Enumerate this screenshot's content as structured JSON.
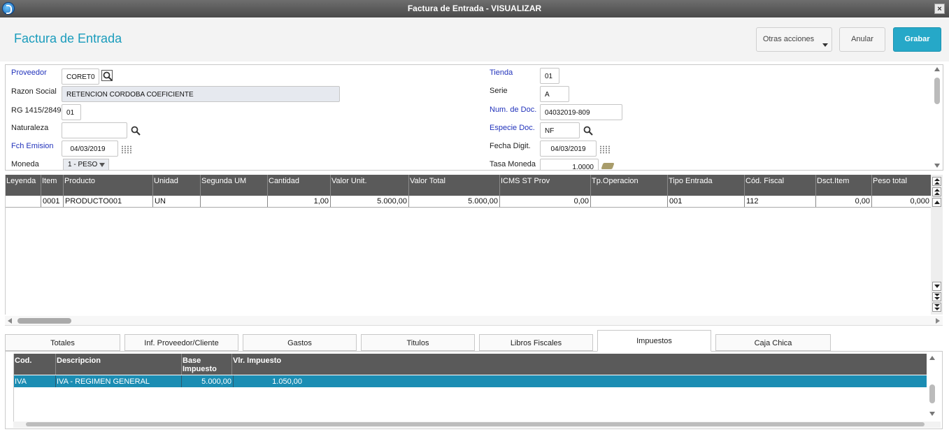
{
  "window": {
    "title": "Factura de Entrada - VISUALIZAR",
    "close": "×"
  },
  "header": {
    "title": "Factura de Entrada",
    "otras_acciones": "Otras acciones",
    "anular": "Anular",
    "grabar": "Grabar"
  },
  "form": {
    "proveedor_label": "Proveedor",
    "proveedor": "CORET0",
    "razon_social_label": "Razon Social",
    "razon_social": "RETENCION CORDOBA COEFICIENTE",
    "rg_label": "RG 1415/2849",
    "rg": "01",
    "naturaleza_label": "Naturaleza",
    "naturaleza": "",
    "fch_emision_label": "Fch Emision",
    "fch_emision": "04/03/2019",
    "moneda_label": "Moneda",
    "moneda": "1 - PESO",
    "tienda_label": "Tienda",
    "tienda": "01",
    "serie_label": "Serie",
    "serie": "A",
    "num_doc_label": "Num. de Doc.",
    "num_doc": "04032019-809",
    "especie_label": "Especie Doc.",
    "especie": "NF",
    "fecha_digit_label": "Fecha Digit.",
    "fecha_digit": "04/03/2019",
    "tasa_label": "Tasa Moneda",
    "tasa": "1.0000"
  },
  "items_grid": {
    "columns": [
      "Leyenda",
      "Item",
      "Producto",
      "Unidad",
      "Segunda UM",
      "Cantidad",
      "Valor Unit.",
      "Valor Total",
      "ICMS ST Prov",
      "Tp.Operacion",
      "Tipo Entrada",
      "Cód. Fiscal",
      "Dsct.Item",
      "Peso total"
    ],
    "row": {
      "leyenda": "",
      "item": "0001",
      "producto": "PRODUCTO001",
      "unidad": "UN",
      "segunda_um": "",
      "cantidad": "1,00",
      "valor_unit": "5.000,00",
      "valor_total": "5.000,00",
      "icms": "0,00",
      "tp_operacion": "",
      "tipo_entrada": "001",
      "cod_fiscal": "112",
      "dsct_item": "0,00",
      "peso_total": "0,000"
    }
  },
  "tabs": [
    "Totales",
    "Inf. Proveedor/Cliente",
    "Gastos",
    "Titulos",
    "Libros Fiscales",
    "Impuestos",
    "Caja Chica"
  ],
  "active_tab": "Impuestos",
  "tax_grid": {
    "columns": [
      "Cod.",
      "Descripcion",
      "Base Impuesto",
      "Vlr. Impuesto"
    ],
    "row": {
      "cod": "IVA",
      "descripcion": "IVA - REGIMEN GENERAL",
      "base": "5.000,00",
      "valor": "1.050,00"
    }
  },
  "colors": {
    "accent": "#26a8c8",
    "title": "#1a9cbc",
    "header_grid": "#5a5a5a",
    "selected_row": "#1b8db3"
  }
}
